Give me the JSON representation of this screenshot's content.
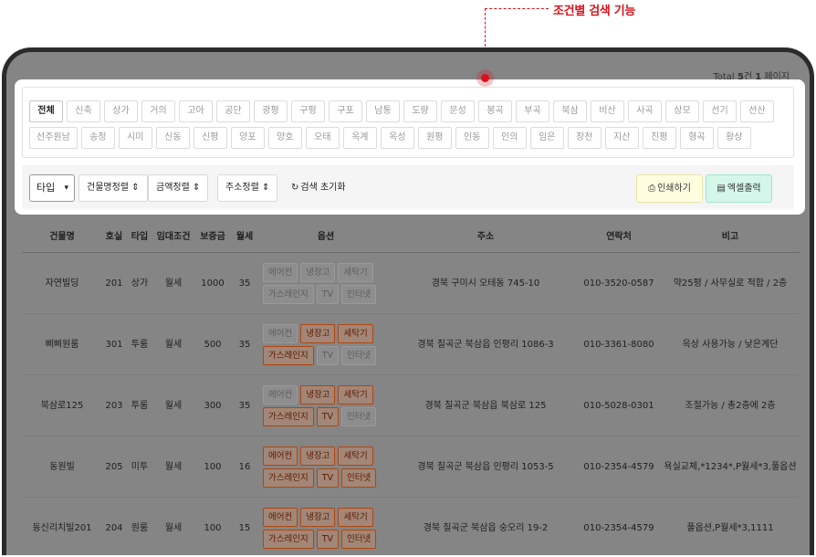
{
  "callout": {
    "title": "조건별 검색 기능",
    "color": "#d8131b"
  },
  "total": {
    "prefix": "Total ",
    "count": "5",
    "middle": "건 ",
    "pages": "1",
    "suffix": " 페이지"
  },
  "chips": [
    "전체",
    "신축",
    "상가",
    "거의",
    "고아",
    "공단",
    "광평",
    "구평",
    "구포",
    "남통",
    "도량",
    "문성",
    "봉곡",
    "부곡",
    "북삼",
    "비산",
    "사곡",
    "상모",
    "선기",
    "선산",
    "선주원남",
    "송정",
    "시미",
    "신동",
    "신평",
    "양포",
    "양호",
    "오태",
    "옥계",
    "옥성",
    "원평",
    "인동",
    "인의",
    "임은",
    "장천",
    "지산",
    "진평",
    "형곡",
    "황상"
  ],
  "active_chip": "전체",
  "filter": {
    "type_label": "타입",
    "sort_building": "건물명정렬",
    "sort_price": "금액정렬",
    "sort_address": "주소정렬",
    "reset": "검색 초기화",
    "print": "인쇄하기",
    "excel": "엑셀출력"
  },
  "table": {
    "headers": [
      "건물명",
      "호실",
      "타입",
      "임대조건",
      "보증금",
      "월세",
      "옵션",
      "주소",
      "연락처",
      "비고"
    ],
    "option_labels": [
      "에어컨",
      "냉장고",
      "세탁기",
      "가스레인지",
      "TV",
      "인터넷"
    ],
    "rows": [
      {
        "name": "자연빌딩",
        "room": "201",
        "type": "상가",
        "cond": "월세",
        "deposit": "1000",
        "rent": "35",
        "options": [
          false,
          false,
          false,
          false,
          false,
          false
        ],
        "address": "경북 구미시 오테동 745-10",
        "phone": "010-3520-0587",
        "note": "약25평 / 사무실로 적합 / 2층"
      },
      {
        "name": "삐삐원룸",
        "room": "301",
        "type": "투룸",
        "cond": "월세",
        "deposit": "500",
        "rent": "35",
        "options": [
          false,
          true,
          true,
          true,
          false,
          false
        ],
        "address": "경북 칠곡군 북삼읍 인평리 1086-3",
        "phone": "010-3361-8080",
        "note": "옥상 사용가능 / 낮은계단"
      },
      {
        "name": "북삼로125",
        "room": "203",
        "type": "투룸",
        "cond": "월세",
        "deposit": "300",
        "rent": "35",
        "options": [
          false,
          true,
          true,
          true,
          true,
          false
        ],
        "address": "경북 칠곡군 북삼읍 북삼로 125",
        "phone": "010-5028-0301",
        "note": "조절가능 / 총2층에 2층"
      },
      {
        "name": "동원빌",
        "room": "205",
        "type": "미투",
        "cond": "월세",
        "deposit": "100",
        "rent": "16",
        "options": [
          true,
          true,
          true,
          true,
          true,
          true
        ],
        "address": "경북 칠곡군 북삼읍 인평리 1053-5",
        "phone": "010-2354-4579",
        "note": "욕실교체,*1234*,P월세*3,풀옵션"
      },
      {
        "name": "동신리치빌201",
        "room": "204",
        "type": "원룸",
        "cond": "월세",
        "deposit": "100",
        "rent": "15",
        "options": [
          true,
          true,
          true,
          true,
          true,
          true
        ],
        "address": "경북 칠곡군 북삼읍 숭오리 19-2",
        "phone": "010-2354-4579",
        "note": "풀옵션,P월세*3,1111"
      }
    ]
  }
}
